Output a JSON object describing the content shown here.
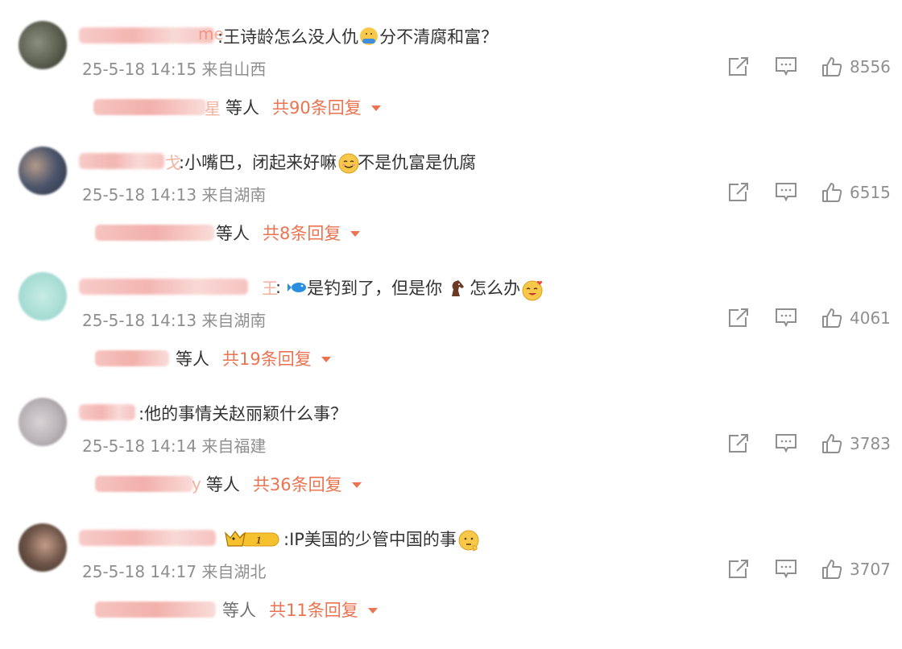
{
  "comments": [
    {
      "text_parts": [
        ":王诗龄怎么没人仇",
        "分不清腐和富？"
      ],
      "name_tail": "me",
      "meta": "25-5-18 14:15 来自山西",
      "likes": "8556",
      "reply_who": "等人",
      "reply_count": "共90条回复",
      "reply_tail": "星",
      "avatar_color": "#5a5f4f"
    },
    {
      "text_parts": [
        ":小嘴巴，闭起来好嘛",
        "不是仇富是仇腐"
      ],
      "name_tail": "戈",
      "meta": "25-5-18 14:13 来自湖南",
      "likes": "6515",
      "reply_who": "等人",
      "reply_count": "共8条回复",
      "avatar_color": "#4b556b"
    },
    {
      "text_parts": [
        ":",
        "是钓到了，但是你",
        "怎么办"
      ],
      "name_tail": "王",
      "meta": "25-5-18 14:13 来自湖南",
      "likes": "4061",
      "reply_who": "等人",
      "reply_count": "共19条回复",
      "avatar_color": "#a8ddd4"
    },
    {
      "text_parts": [
        ":他的事情关赵丽颖什么事？"
      ],
      "meta": "25-5-18 14:14 来自福建",
      "likes": "3783",
      "reply_who": "等人",
      "reply_count": "共36条回复",
      "reply_tail": "y",
      "avatar_color": "#b8b2b6"
    },
    {
      "text_parts": [
        ":IP美国的少管中国的事"
      ],
      "badge_text": "1",
      "meta": "25-5-18 14:17 来自湖北",
      "likes": "3707",
      "reply_who": "等人",
      "reply_count": "共11条回复",
      "avatar_color": "#6e5548"
    }
  ],
  "icons": [
    "share-icon",
    "comment-icon",
    "like-icon",
    "chevron-down-icon"
  ],
  "colors": {
    "accent": "#eb7350",
    "muted": "#8f8f8f",
    "text": "#333333"
  }
}
